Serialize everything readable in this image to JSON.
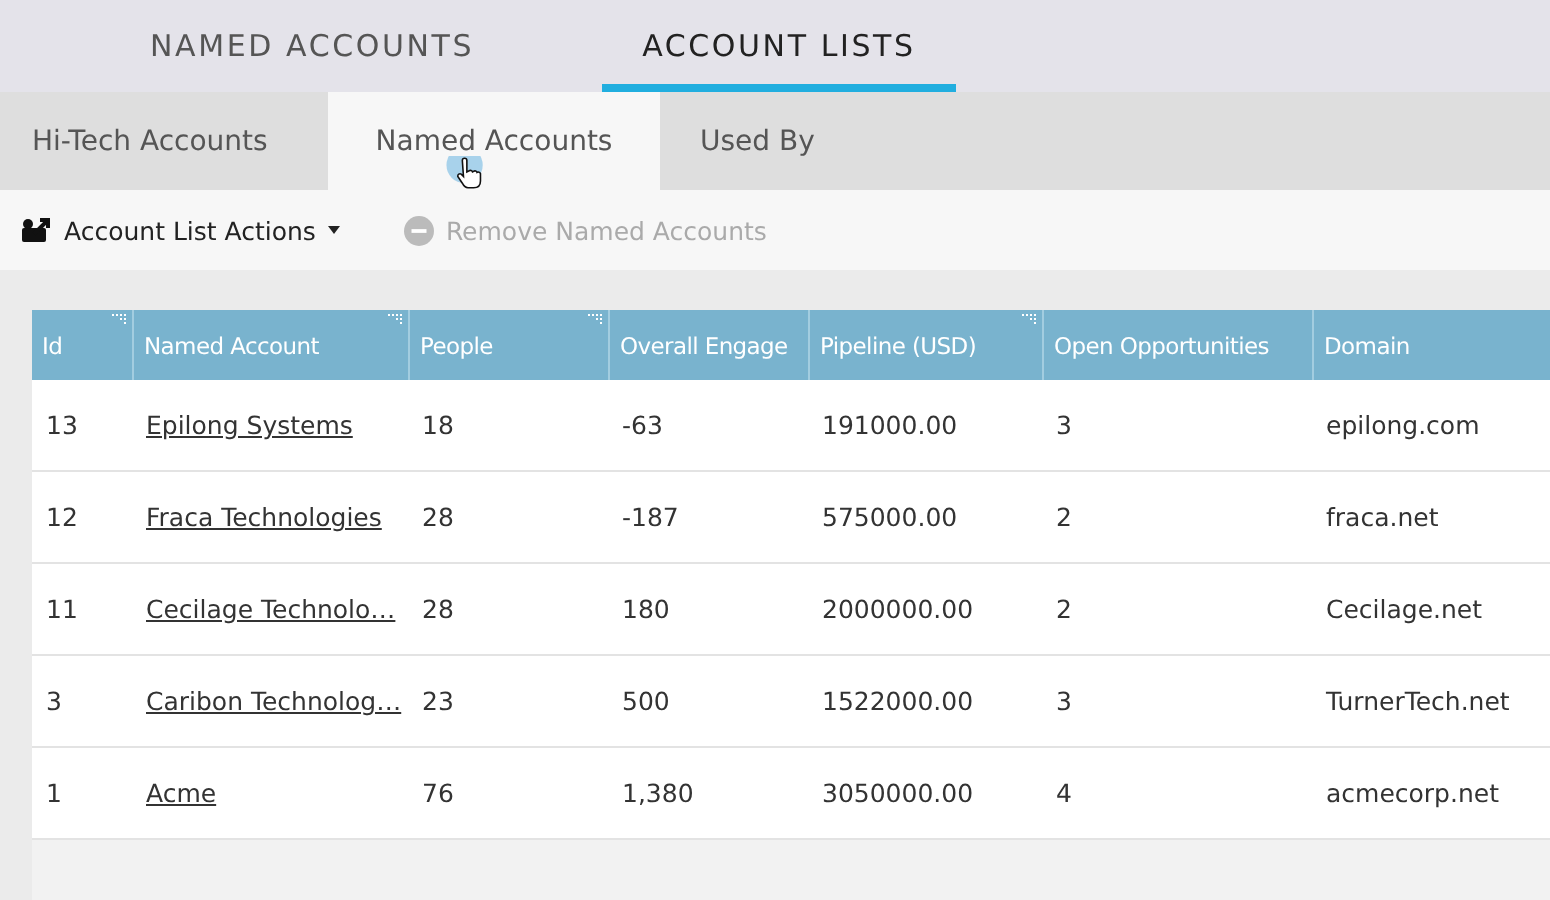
{
  "top_tabs": [
    {
      "label": "NAMED ACCOUNTS",
      "selected": false
    },
    {
      "label": "ACCOUNT LISTS",
      "selected": true
    }
  ],
  "sub_tabs": [
    {
      "label": "Hi-Tech Accounts",
      "selected": false
    },
    {
      "label": "Named Accounts",
      "selected": true
    },
    {
      "label": "Used By",
      "selected": false
    }
  ],
  "toolbar": [
    {
      "label": "Account List Actions",
      "kind": "menu",
      "disabled": false
    },
    {
      "label": "Remove Named Accounts",
      "kind": "remove",
      "disabled": true
    }
  ],
  "table": {
    "columns": [
      {
        "label": "Id",
        "resizable": true
      },
      {
        "label": "Named Account",
        "resizable": true
      },
      {
        "label": "People",
        "resizable": true
      },
      {
        "label": "Overall Engage",
        "resizable": false
      },
      {
        "label": "Pipeline (USD)",
        "resizable": true
      },
      {
        "label": "Open Opportunities",
        "resizable": false
      },
      {
        "label": "Domain",
        "resizable": false
      }
    ],
    "rows": [
      [
        "13",
        "Epilong Systems",
        "18",
        "-63",
        "191000.00",
        "3",
        "epilong.com"
      ],
      [
        "12",
        "Fraca Technologies",
        "28",
        "-187",
        "575000.00",
        "2",
        "fraca.net"
      ],
      [
        "11",
        "Cecilage Technolo…",
        "28",
        "180",
        "2000000.00",
        "2",
        "Cecilage.net"
      ],
      [
        "3",
        "Caribon Technolog…",
        "23",
        "500",
        "1522000.00",
        "3",
        "TurnerTech.net"
      ],
      [
        "1",
        "Acme",
        "76",
        "1,380",
        "3050000.00",
        "4",
        "acmecorp.net"
      ]
    ]
  }
}
